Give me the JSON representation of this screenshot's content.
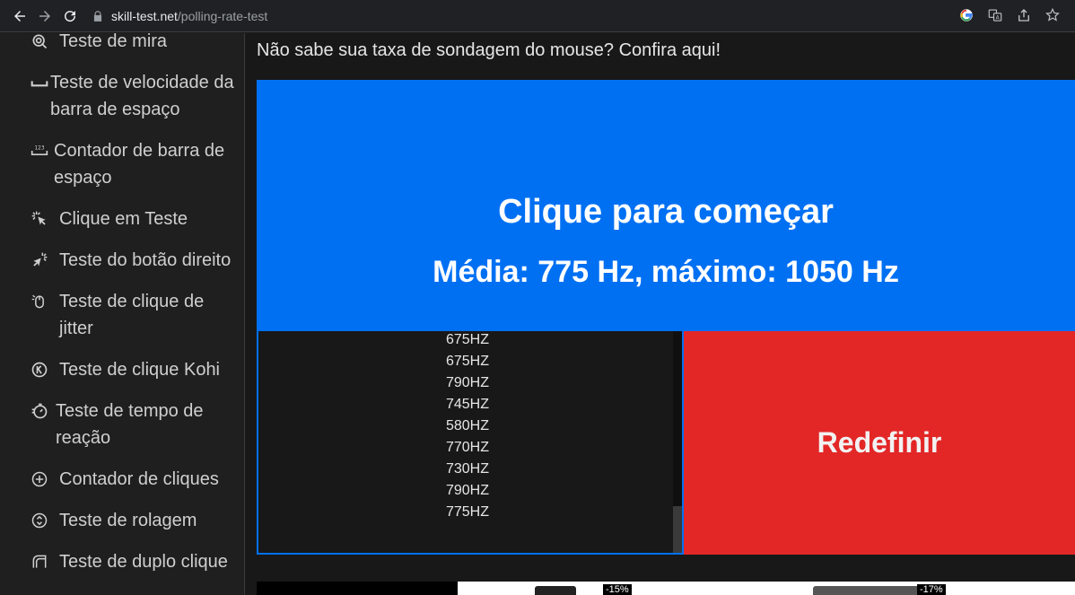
{
  "browser": {
    "url_host": "skill-test.net",
    "url_path": "/polling-rate-test"
  },
  "sidebar": {
    "items": [
      {
        "label": "Teste de mira",
        "icon": "crosshair-icon"
      },
      {
        "label": "Teste de velocidade da barra de espaço",
        "icon": "spacebar-icon"
      },
      {
        "label": "Contador de barra de espaço",
        "icon": "spacebar-counter-icon"
      },
      {
        "label": "Clique em Teste",
        "icon": "click-icon"
      },
      {
        "label": "Teste do botão direito",
        "icon": "right-click-icon"
      },
      {
        "label": "Teste de clique de jitter",
        "icon": "jitter-click-icon"
      },
      {
        "label": "Teste de clique Kohi",
        "icon": "kohi-icon"
      },
      {
        "label": "Teste de tempo de reação",
        "icon": "stopwatch-icon"
      },
      {
        "label": "Contador de cliques",
        "icon": "plus-circle-icon"
      },
      {
        "label": "Teste de rolagem",
        "icon": "scroll-icon"
      },
      {
        "label": "Teste de duplo clique",
        "icon": "double-click-icon"
      }
    ]
  },
  "main": {
    "hint": "Não sabe sua taxa de sondagem do mouse? Confira aqui!",
    "click_area": {
      "title": "Clique para começar",
      "stats": "Média: 775 Hz, máximo: 1050 Hz"
    },
    "log": [
      "675HZ",
      "675HZ",
      "790HZ",
      "745HZ",
      "580HZ",
      "770HZ",
      "730HZ",
      "790HZ",
      "775HZ"
    ],
    "reset_label": "Redefinir"
  },
  "ads": {
    "badges": [
      "-15%",
      "-17%"
    ]
  },
  "colors": {
    "accent": "#0070f3",
    "reset": "#e32727"
  }
}
